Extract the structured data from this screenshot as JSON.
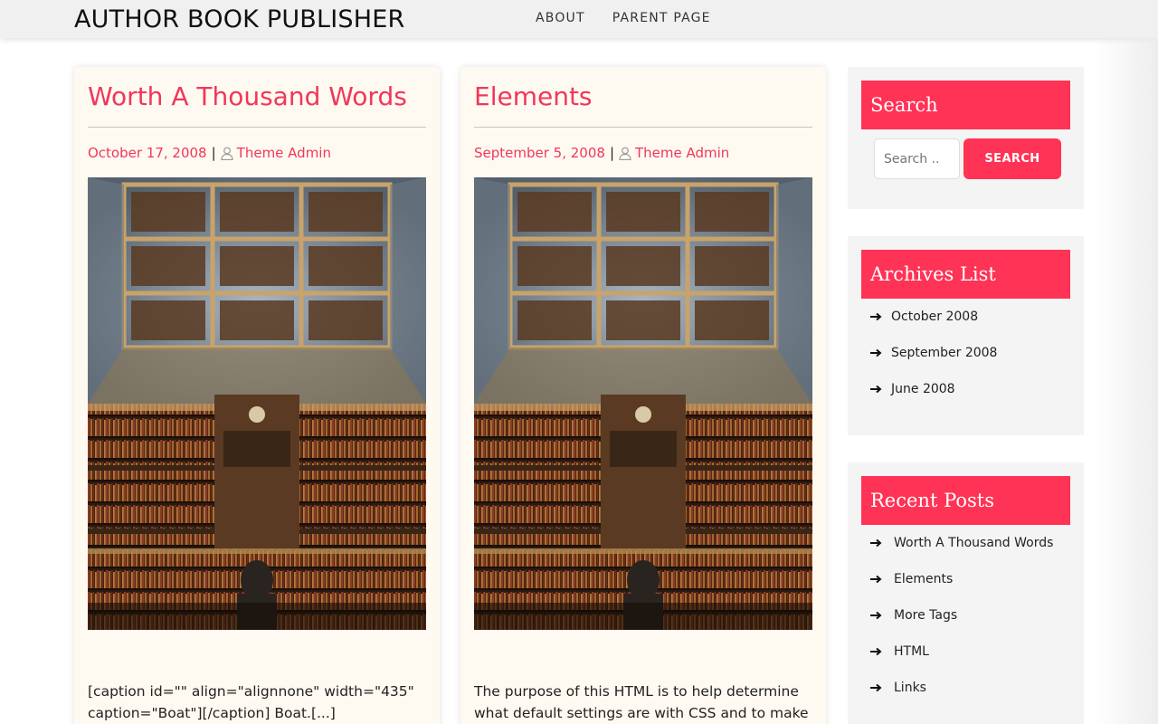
{
  "header": {
    "site_title": "AUTHOR BOOK PUBLISHER",
    "nav": [
      "ABOUT",
      "PARENT PAGE"
    ]
  },
  "posts": [
    {
      "title": "Worth A Thousand Words",
      "date": "October 17, 2008",
      "separator": "|",
      "author": "Theme Admin",
      "excerpt": "[caption id=\"\" align=\"alignnone\" width=\"435\" caption=\"Boat\"][/caption] Boat.[...]"
    },
    {
      "title": "Elements",
      "date": "September 5, 2008",
      "separator": "|",
      "author": "Theme Admin",
      "excerpt": "The purpose of this HTML is to help determine what default settings are with CSS and to make"
    }
  ],
  "sidebar": {
    "search": {
      "title": "Search",
      "placeholder": "Search ..",
      "button": "SEARCH"
    },
    "archives": {
      "title": "Archives List",
      "items": [
        "October 2008",
        "September 2008",
        "June 2008"
      ]
    },
    "recent": {
      "title": "Recent Posts",
      "items": [
        "Worth A Thousand Words",
        "Elements",
        "More Tags",
        "HTML",
        "Links"
      ]
    }
  },
  "colors": {
    "accent": "#ff3355",
    "link": "#f0375a",
    "card_bg": "#fffaf1",
    "widget_bg": "#f4f4f4"
  }
}
